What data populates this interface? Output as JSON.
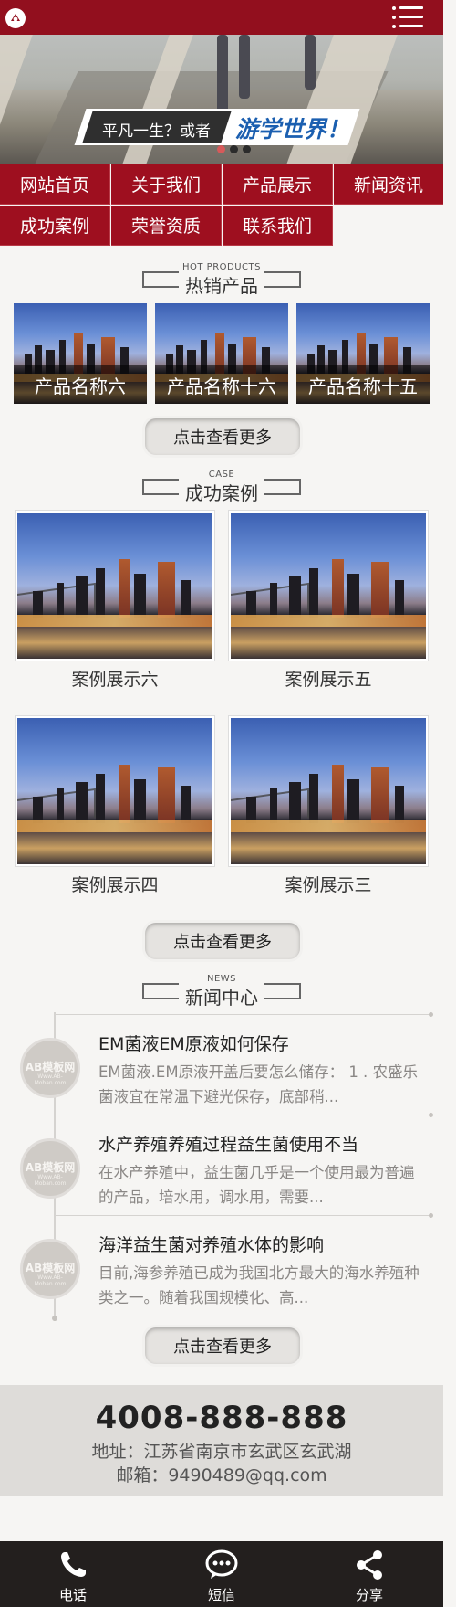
{
  "header": {
    "logo_icon": "logo-icon",
    "menu_icon": "menu-icon",
    "brand_color": "#920f1e"
  },
  "banner": {
    "slogan": "平凡一生？或者",
    "highlight": "游学世界！",
    "slide_count": 3,
    "active_slide": 1
  },
  "nav": {
    "items": [
      {
        "label": "网站首页"
      },
      {
        "label": "关于我们"
      },
      {
        "label": "产品展示"
      },
      {
        "label": "新闻资讯"
      },
      {
        "label": "成功案例"
      },
      {
        "label": "荣誉资质"
      },
      {
        "label": "联系我们"
      }
    ]
  },
  "products": {
    "en_title": "HOT PRODUCTS",
    "title": "热销产品",
    "items": [
      {
        "name": "产品名称六"
      },
      {
        "name": "产品名称十六"
      },
      {
        "name": "产品名称十五"
      }
    ],
    "more_label": "点击查看更多"
  },
  "cases": {
    "en_title": "CASE",
    "title": "成功案例",
    "items": [
      {
        "name": "案例展示六"
      },
      {
        "name": "案例展示五"
      },
      {
        "name": "案例展示四"
      },
      {
        "name": "案例展示三"
      }
    ],
    "more_label": "点击查看更多"
  },
  "news": {
    "en_title": "NEWS",
    "title": "新闻中心",
    "avatar_text": "AB模板网",
    "avatar_sub": "Www.AB-Moban.com",
    "items": [
      {
        "title": "EM菌液EM原液如何保存",
        "desc": "EM菌液.EM原液开盖后要怎么储存： 1 . 农盛乐菌液宜在常温下避光保存，底部稍..."
      },
      {
        "title": "水产养殖养殖过程益生菌使用不当",
        "desc": "在水产养殖中，益生菌几乎是一个使用最为普遍的产品，培水用，调水用，需要..."
      },
      {
        "title": "海洋益生菌对养殖水体的影响",
        "desc": "目前,海参养殖已成为我国北方最大的海水养殖种类之一。随着我国规模化、高..."
      }
    ],
    "more_label": "点击查看更多"
  },
  "contact": {
    "phone": "4008-888-888",
    "address": "地址：江苏省南京市玄武区玄武湖",
    "email": "邮箱：9490489@qq.com"
  },
  "bottom_bar": {
    "items": [
      {
        "label": "电话",
        "icon": "phone-icon"
      },
      {
        "label": "短信",
        "icon": "sms-icon"
      },
      {
        "label": "分享",
        "icon": "share-icon"
      }
    ]
  }
}
